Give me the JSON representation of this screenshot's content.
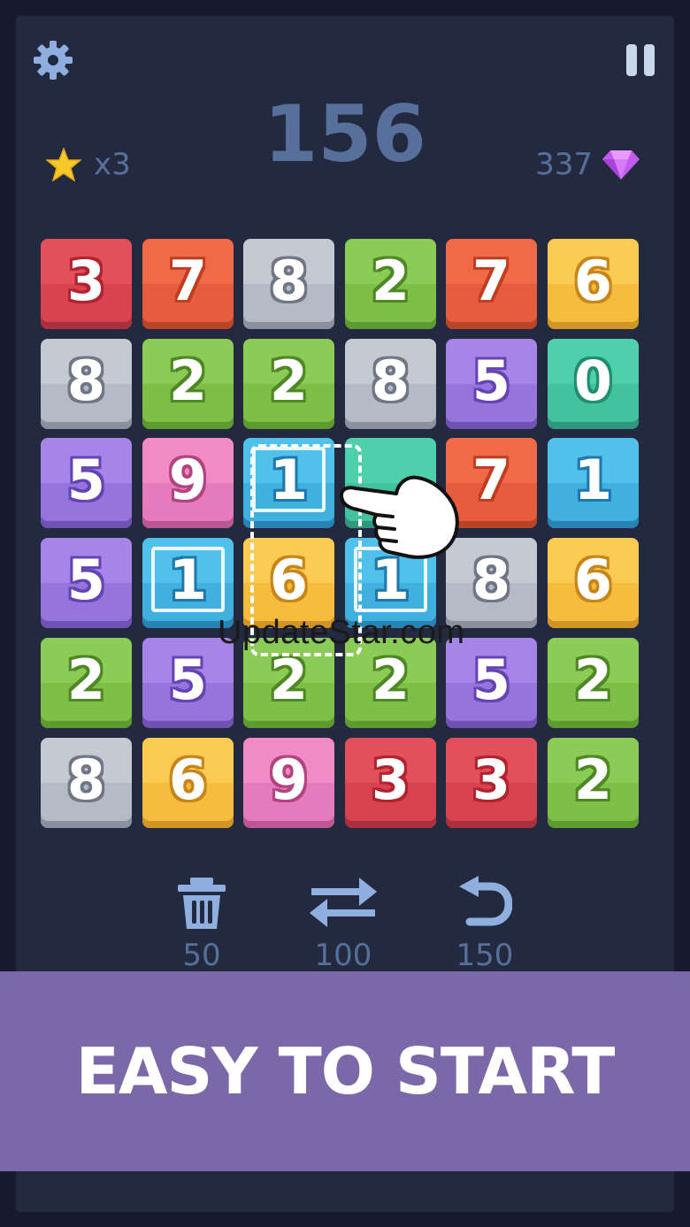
{
  "hud": {
    "score": "156",
    "stars": "x3",
    "gems": "337"
  },
  "board": {
    "rows": [
      [
        {
          "n": "3",
          "color": "red"
        },
        {
          "n": "7",
          "color": "orange"
        },
        {
          "n": "8",
          "color": "gray"
        },
        {
          "n": "2",
          "color": "green"
        },
        {
          "n": "7",
          "color": "orange"
        },
        {
          "n": "6",
          "color": "yellow"
        }
      ],
      [
        {
          "n": "8",
          "color": "gray"
        },
        {
          "n": "2",
          "color": "green"
        },
        {
          "n": "2",
          "color": "green"
        },
        {
          "n": "8",
          "color": "gray"
        },
        {
          "n": "5",
          "color": "purple"
        },
        {
          "n": "0",
          "color": "teal"
        }
      ],
      [
        {
          "n": "5",
          "color": "purple"
        },
        {
          "n": "9",
          "color": "pink"
        },
        {
          "n": "1",
          "color": "blue",
          "selected": true
        },
        {
          "n": "",
          "color": "teal"
        },
        {
          "n": "7",
          "color": "orange"
        },
        {
          "n": "1",
          "color": "blue"
        }
      ],
      [
        {
          "n": "5",
          "color": "purple"
        },
        {
          "n": "1",
          "color": "blue",
          "selected": true
        },
        {
          "n": "6",
          "color": "yellow"
        },
        {
          "n": "1",
          "color": "blue",
          "selected": true
        },
        {
          "n": "8",
          "color": "gray"
        },
        {
          "n": "6",
          "color": "yellow"
        }
      ],
      [
        {
          "n": "2",
          "color": "green"
        },
        {
          "n": "5",
          "color": "purple"
        },
        {
          "n": "2",
          "color": "green"
        },
        {
          "n": "2",
          "color": "green"
        },
        {
          "n": "5",
          "color": "purple"
        },
        {
          "n": "2",
          "color": "green"
        }
      ],
      [
        {
          "n": "8",
          "color": "gray"
        },
        {
          "n": "6",
          "color": "yellow"
        },
        {
          "n": "9",
          "color": "pink"
        },
        {
          "n": "3",
          "color": "red"
        },
        {
          "n": "3",
          "color": "red"
        },
        {
          "n": "2",
          "color": "green"
        }
      ]
    ]
  },
  "watermark": "UpdateStar.com",
  "tools": [
    {
      "icon": "trash-icon",
      "cost": "50"
    },
    {
      "icon": "swap-icon",
      "cost": "100"
    },
    {
      "icon": "undo-icon",
      "cost": "150"
    }
  ],
  "banner": {
    "text": "EASY TO START"
  },
  "colors": {
    "background": "#232a40",
    "hud_text": "#56709b",
    "banner": "#7a68a8"
  }
}
